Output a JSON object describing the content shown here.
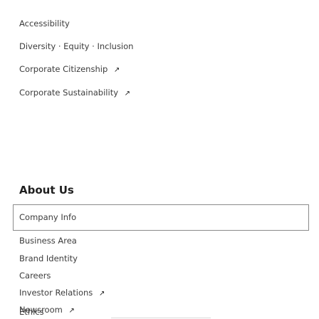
{
  "top_links": [
    {
      "label": "Accessibility",
      "external": false
    },
    {
      "label": "Diversity · Equity · Inclusion",
      "external": false
    },
    {
      "label": "Corporate Citizenship",
      "external": true
    },
    {
      "label": "Corporate Sustainability",
      "external": true
    }
  ],
  "about": {
    "title": "About Us",
    "focused_link": {
      "label": "Company Info",
      "external": false
    },
    "links": [
      {
        "label": "Business Area",
        "external": false
      },
      {
        "label": "Brand Identity",
        "external": false
      },
      {
        "label": "Careers",
        "external": false
      },
      {
        "label": "Investor Relations",
        "external": true
      },
      {
        "label": "Newsroom",
        "external": true
      },
      {
        "label": "Ethics",
        "external": false
      }
    ]
  },
  "icons": {
    "external": "↗"
  }
}
